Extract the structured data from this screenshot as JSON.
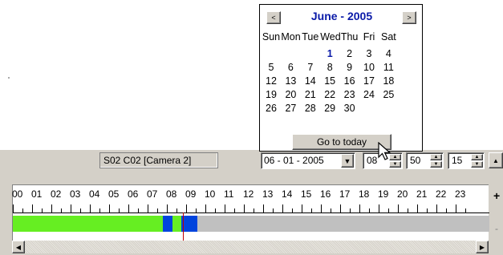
{
  "calendar": {
    "title": "June - 2005",
    "prev_label": "<",
    "next_label": ">",
    "weekdays": [
      "Sun",
      "Mon",
      "Tue",
      "Wed",
      "Thu",
      "Fri",
      "Sat"
    ],
    "weeks": [
      [
        "",
        "",
        "",
        "1",
        "2",
        "3",
        "4"
      ],
      [
        "5",
        "6",
        "7",
        "8",
        "9",
        "10",
        "11"
      ],
      [
        "12",
        "13",
        "14",
        "15",
        "16",
        "17",
        "18"
      ],
      [
        "19",
        "20",
        "21",
        "22",
        "23",
        "24",
        "25"
      ],
      [
        "26",
        "27",
        "28",
        "29",
        "30",
        "",
        ""
      ]
    ],
    "today": "1",
    "goto_today_label": "Go to today"
  },
  "toolbar": {
    "camera_label": "S02 C02 [Camera 2]",
    "date_value": "06 - 01 - 2005",
    "hour_value": "08",
    "minute_value": "50",
    "second_value": "15"
  },
  "timeline": {
    "hours": [
      "00",
      "01",
      "02",
      "03",
      "04",
      "05",
      "06",
      "07",
      "08",
      "09",
      "10",
      "11",
      "12",
      "13",
      "14",
      "15",
      "16",
      "17",
      "18",
      "19",
      "20",
      "21",
      "22",
      "23"
    ],
    "plus_label": "+",
    "minus_label": "-",
    "segments": [
      {
        "start_hour": 0.0,
        "end_hour": 7.8,
        "color": "#66ee22"
      },
      {
        "start_hour": 7.8,
        "end_hour": 8.3,
        "color": "#0044dd"
      },
      {
        "start_hour": 8.3,
        "end_hour": 8.75,
        "color": "#66ee22"
      },
      {
        "start_hour": 8.75,
        "end_hour": 9.6,
        "color": "#0044dd"
      }
    ],
    "cursor_hour": 8.83,
    "track_color": "#c0c0c0"
  },
  "colors": {
    "title_blue": "#0a1aa8",
    "panel_gray": "#d4d0c8"
  }
}
